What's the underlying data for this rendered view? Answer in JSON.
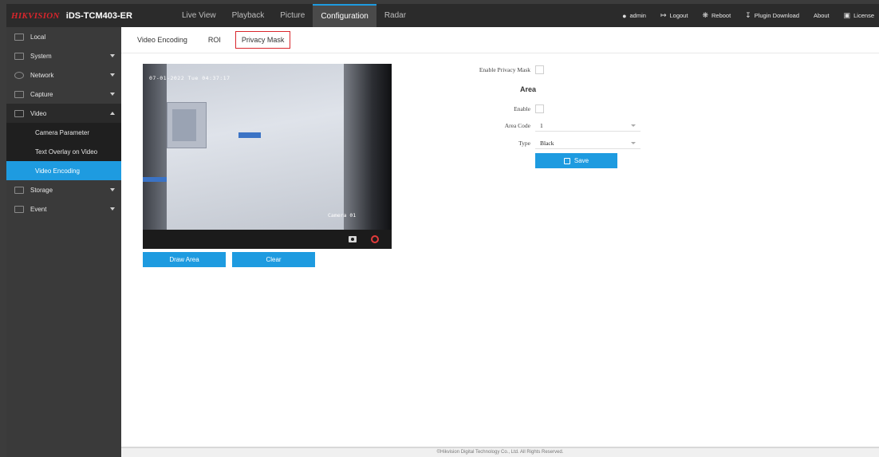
{
  "brand": {
    "model": "iDS-TCM403-ER"
  },
  "nav": [
    {
      "label": "Live View",
      "active": false
    },
    {
      "label": "Playback",
      "active": false
    },
    {
      "label": "Picture",
      "active": false
    },
    {
      "label": "Configuration",
      "active": true
    },
    {
      "label": "Radar",
      "active": false
    }
  ],
  "right_menu": {
    "user": "admin",
    "logout": "Logout",
    "reboot": "Reboot",
    "plugin": "Plugin Download",
    "about": "About",
    "license": "License"
  },
  "sidebar": {
    "items": [
      {
        "label": "Local"
      },
      {
        "label": "System"
      },
      {
        "label": "Network"
      },
      {
        "label": "Capture"
      },
      {
        "label": "Video"
      },
      {
        "label": "Storage"
      },
      {
        "label": "Event"
      }
    ],
    "video_sub": [
      {
        "label": "Camera Parameter"
      },
      {
        "label": "Text Overlay on Video"
      },
      {
        "label": "Video Encoding"
      }
    ]
  },
  "subtabs": [
    {
      "label": "Video Encoding"
    },
    {
      "label": "ROI"
    },
    {
      "label": "Privacy Mask"
    }
  ],
  "video": {
    "osd_time": "07-01-2022 Tue 04:37:17",
    "osd_camera": "Camera 01"
  },
  "buttons": {
    "draw_area": "Draw Area",
    "clear": "Clear",
    "save": "Save"
  },
  "form": {
    "enable_privacy_mask_label": "Enable Privacy Mask",
    "area_title": "Area",
    "enable_label": "Enable",
    "area_code_label": "Area Code",
    "area_code_value": "1",
    "type_label": "Type",
    "type_value": "Black"
  },
  "footer": "©Hikvision Digital Technology Co., Ltd. All Rights Reserved.",
  "colors": {
    "accent": "#1e9be0",
    "brand_red": "#d9262c",
    "topbar": "#2b2b2b",
    "sidebar": "#3a3a3a"
  }
}
